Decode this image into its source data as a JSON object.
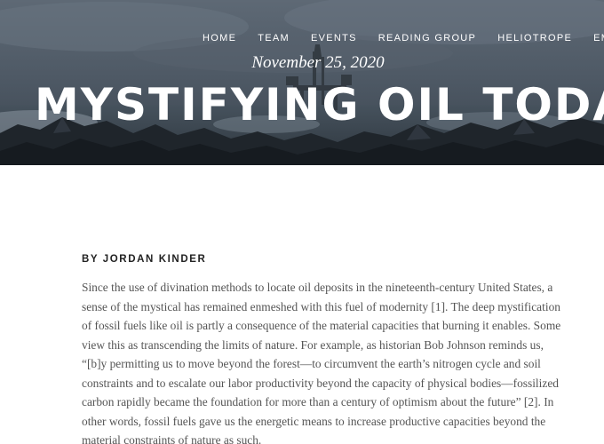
{
  "nav": {
    "items": [
      {
        "label": "HOME"
      },
      {
        "label": "TEAM"
      },
      {
        "label": "EVENTS"
      },
      {
        "label": "READING GROUP"
      },
      {
        "label": "HELIOTROPE"
      },
      {
        "label": "EML SOU"
      }
    ]
  },
  "hero": {
    "date": "November 25, 2020",
    "title": "MYSTIFYING OIL TODAY"
  },
  "article": {
    "byline": "BY JORDAN KINDER",
    "lines": [
      "Since the use of divination methods to locate oil deposits in the nineteenth-century United States, a",
      "sense of the mystical has remained enmeshed with this fuel of modernity [1]. The deep mystification",
      "of fossil fuels like oil is partly a consequence of the material capacities that burning it enables. Some",
      "view this as transcending the limits of nature. For example, as historian Bob Johnson reminds us,",
      "“[b]y permitting us to move beyond the forest—to circumvent the earth’s nitrogen cycle and soil",
      "constraints and to escalate our labor productivity beyond the capacity of physical bodies—fossilized",
      "carbon rapidly became the foundation for more than a century of optimism about the future” [2]. In",
      "other words, fossil fuels gave us the energetic means to increase productive capacities beyond the",
      "material constraints of nature as such."
    ]
  }
}
